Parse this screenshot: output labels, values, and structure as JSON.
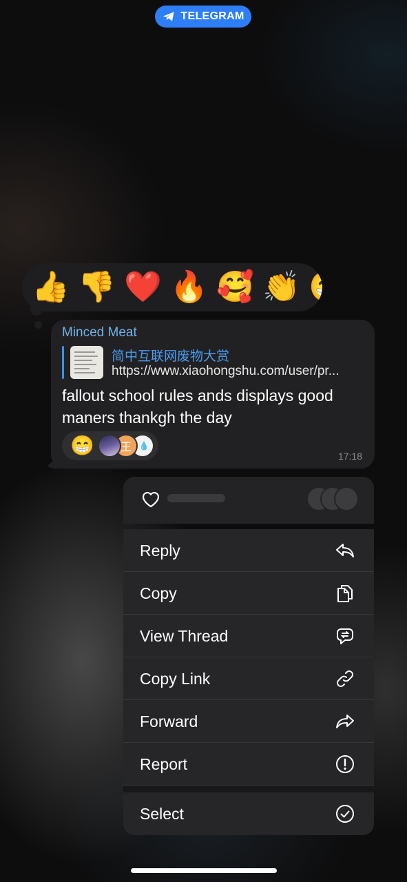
{
  "banner": {
    "app": "TELEGRAM",
    "accent": "#2d7ef7"
  },
  "reactions": [
    "👍",
    "👎",
    "❤️",
    "🔥",
    "🥰",
    "👏",
    "😁"
  ],
  "message": {
    "sender": "Minced Meat",
    "link_title": "简中互联网废物大赏",
    "link_url": "https://www.xiaohongshu.com/user/pr...",
    "text": "fallout school rules ands displays good maners thankgh the day",
    "reaction_emoji": "😁",
    "avatar_2_text": "王",
    "avatar_3_text": "·💧",
    "time": "17:18"
  },
  "menu": {
    "items": [
      {
        "label": "Reply",
        "icon": "reply-icon"
      },
      {
        "label": "Copy",
        "icon": "copy-icon"
      },
      {
        "label": "View Thread",
        "icon": "thread-icon"
      },
      {
        "label": "Copy Link",
        "icon": "link-icon"
      },
      {
        "label": "Forward",
        "icon": "forward-icon"
      },
      {
        "label": "Report",
        "icon": "report-icon"
      }
    ],
    "select": {
      "label": "Select",
      "icon": "select-icon"
    }
  }
}
